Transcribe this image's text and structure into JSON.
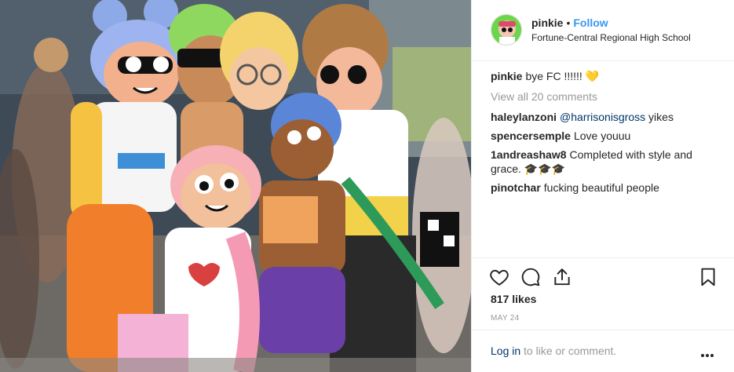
{
  "post": {
    "username": "pinkie",
    "dot": "•",
    "follow_label": "Follow",
    "location": "Fortune-Central  Regional High School"
  },
  "caption": {
    "user": "pinkie",
    "text": "bye FC !!!!!! 💛"
  },
  "view_all_label": "View all 20 comments",
  "comments": [
    {
      "user": "haleylanzoni",
      "mention": "@harrisonisgross",
      "text": " yikes"
    },
    {
      "user": "spencersemple",
      "text": "Love youuu"
    },
    {
      "user": "1andreashaw8",
      "text": "Completed with style and grace. 🎓🎓🎓"
    },
    {
      "user": "pinotchar",
      "text": "fucking beautiful people"
    }
  ],
  "likes": "817 likes",
  "date": "MAY 24",
  "login": {
    "link": "Log in",
    "rest": " to like or comment."
  },
  "icons": {
    "like": "heart-icon",
    "comment": "comment-icon",
    "share": "share-icon",
    "save": "bookmark-icon",
    "more": "more-options-icon"
  },
  "colors": {
    "follow": "#3897f0",
    "link": "#003569",
    "muted": "#999999"
  }
}
